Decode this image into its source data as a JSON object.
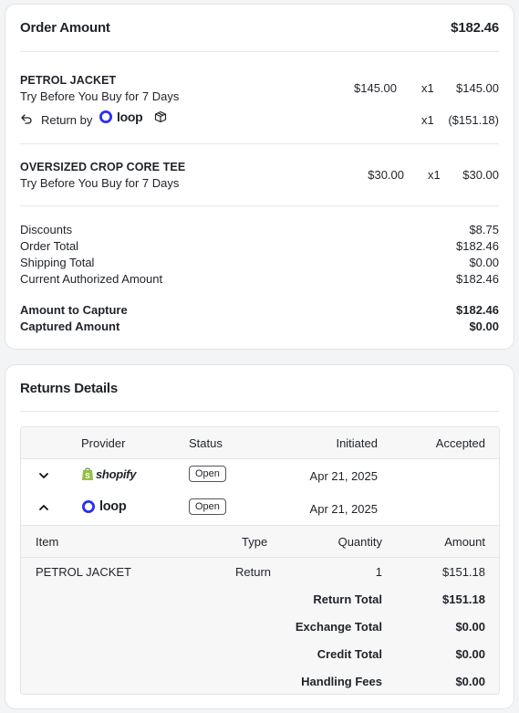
{
  "order": {
    "title": "Order Amount",
    "total": "$182.46",
    "items": [
      {
        "name": "PETROL JACKET",
        "subtitle": "Try Before You Buy for 7 Days",
        "price": "$145.00",
        "qty": "x1",
        "amount": "$145.00",
        "return": {
          "label": "Return by",
          "provider": "loop",
          "qty": "x1",
          "amount": "($151.18)"
        }
      },
      {
        "name": "OVERSIZED CROP CORE TEE",
        "subtitle": "Try Before You Buy for 7 Days",
        "price": "$30.00",
        "qty": "x1",
        "amount": "$30.00"
      }
    ],
    "summary": [
      {
        "label": "Discounts",
        "value": "$8.75"
      },
      {
        "label": "Order Total",
        "value": "$182.46"
      },
      {
        "label": "Shipping Total",
        "value": "$0.00"
      },
      {
        "label": "Current Authorized Amount",
        "value": "$182.46"
      }
    ],
    "capture": [
      {
        "label": "Amount to Capture",
        "value": "$182.46"
      },
      {
        "label": "Captured Amount",
        "value": "$0.00"
      }
    ]
  },
  "returns": {
    "title": "Returns Details",
    "columns": [
      "Provider",
      "Status",
      "Initiated",
      "Accepted"
    ],
    "rows": [
      {
        "provider": "shopify",
        "status": "Open",
        "initiated": "Apr 21, 2025",
        "accepted": "",
        "expanded": false
      },
      {
        "provider": "loop",
        "status": "Open",
        "initiated": "Apr 21, 2025",
        "accepted": "",
        "expanded": true
      }
    ],
    "detail": {
      "columns": [
        "Item",
        "Type",
        "Quantity",
        "Amount"
      ],
      "items": [
        {
          "item": "PETROL JACKET",
          "type": "Return",
          "quantity": "1",
          "amount": "$151.18"
        }
      ],
      "totals": [
        {
          "label": "Return Total",
          "value": "$151.18"
        },
        {
          "label": "Exchange Total",
          "value": "$0.00"
        },
        {
          "label": "Credit Total",
          "value": "$0.00"
        },
        {
          "label": "Handling Fees",
          "value": "$0.00"
        }
      ]
    }
  },
  "colors": {
    "shopify_green": "#95bf47",
    "loop_blue": "#2a2ef5",
    "border": "#e3e4e6"
  },
  "icons": {
    "return": "return-arrow-icon",
    "box": "box-icon",
    "expand": "chevron-down-icon",
    "collapse": "chevron-up-icon"
  }
}
